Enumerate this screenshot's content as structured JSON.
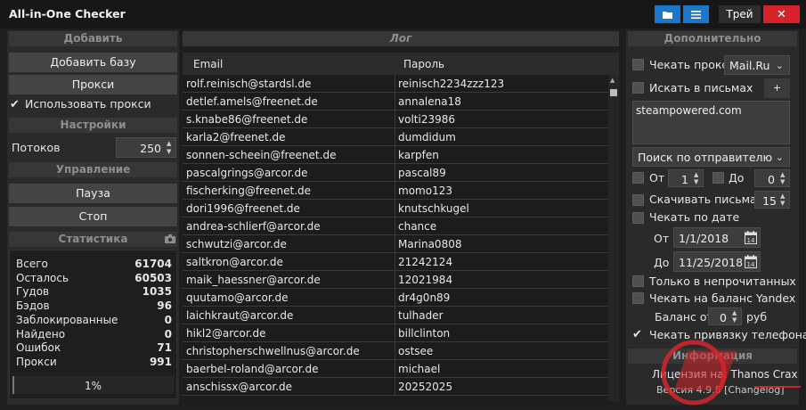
{
  "window": {
    "title": "All-in-One Checker",
    "tray_label": "Трей",
    "close_glyph": "✕",
    "folder_icon": "folder-icon",
    "list_icon": "list-icon",
    "accent": "#1a77cc",
    "close_color": "#d8222a"
  },
  "left": {
    "add_header": "Добавить",
    "add_base": "Добавить базу",
    "proxy": "Прокси",
    "use_proxy": "Использовать прокси",
    "settings_header": "Настройки",
    "threads_label": "Потоков",
    "threads_value": "250",
    "control_header": "Управление",
    "pause": "Пауза",
    "stop": "Стоп",
    "stats_header": "Статистика",
    "camera_icon": "camera-icon",
    "stats": [
      {
        "name": "Всего",
        "value": "61704"
      },
      {
        "name": "Осталось",
        "value": "60503"
      },
      {
        "name": "Гудов",
        "value": "1035"
      },
      {
        "name": "Бэдов",
        "value": "96"
      },
      {
        "name": "Заблокированные",
        "value": "0"
      },
      {
        "name": "Найдено",
        "value": "0"
      },
      {
        "name": "Ошибок",
        "value": "71"
      },
      {
        "name": "Прокси",
        "value": "991"
      }
    ],
    "progress_text": "1%",
    "progress_value": 0.01
  },
  "log": {
    "header": "Лог",
    "col_email": "Email",
    "col_password": "Пароль",
    "rows": [
      [
        "rolf.reinisch@stardsl.de",
        "reinisch2234zzz123"
      ],
      [
        "detlef.amels@freenet.de",
        "annalena18"
      ],
      [
        "s.knabe86@freenet.de",
        "volti23986"
      ],
      [
        "karla2@freenet.de",
        "dumdidum"
      ],
      [
        "sonnen-scheein@freenet.de",
        "karpfen"
      ],
      [
        "pascalgrings@arcor.de",
        "pascal89"
      ],
      [
        "fischerking@freenet.de",
        "momo123"
      ],
      [
        "dori1996@freenet.de",
        "knutschkugel"
      ],
      [
        "andrea-schlierf@arcor.de",
        "chance"
      ],
      [
        "schwutzi@arcor.de",
        "Marina0808"
      ],
      [
        "saltkron@arcor.de",
        "21242124"
      ],
      [
        "maik_haessner@arcor.de",
        "12021984"
      ],
      [
        "quutamo@arcor.de",
        "dr4g0n89"
      ],
      [
        "laichkraut@arcor.de",
        "tulhader"
      ],
      [
        "hikl2@arcor.de",
        "billclinton"
      ],
      [
        "christopherschwellnus@arcor.de",
        "ostsee"
      ],
      [
        "baerbel-roland@arcor.de",
        "michael"
      ],
      [
        "anschissx@arcor.de",
        "20252025"
      ]
    ]
  },
  "right": {
    "header": "Дополнительно",
    "check_proxy": "Чекать прокси",
    "mail_provider": "Mail.Ru",
    "search_in_letters": "Искать в письмах",
    "plus": "+",
    "search_text": "steampowered.com",
    "search_mode": "Поиск по отправителю",
    "from_label": "От",
    "from_value": "1",
    "to_label": "До",
    "to_value": "0",
    "download_letters": "Скачивать письма",
    "download_value": "15",
    "check_by_date": "Чекать по дате",
    "date_from_label": "От",
    "date_from": "1/1/2018",
    "date_to_label": "До",
    "date_to": "11/25/2018",
    "calendar_icon": "calendar-icon",
    "only_unread": "Только в непрочитанных",
    "check_yandex": "Чекать на баланс Yandex",
    "balance_from": "Баланс от",
    "balance_value": "0",
    "currency": "руб",
    "check_phone": "Чекать привязку телефона",
    "info_header": "Информация",
    "license": "Лицензия на: Thanos Crax",
    "version": "Версия 4.9.8 [Changelog]"
  }
}
